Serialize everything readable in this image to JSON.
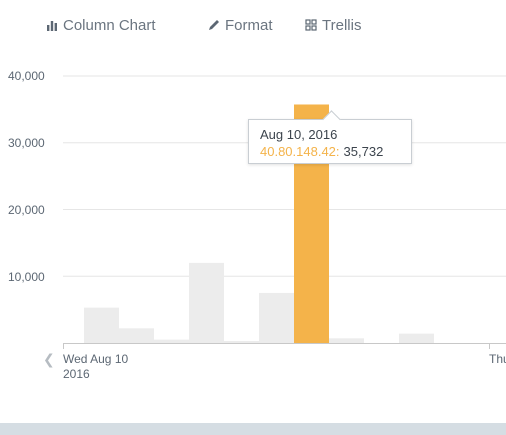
{
  "toolbar": {
    "column_chart": {
      "label": "Column Chart",
      "icon": "bar-chart-icon"
    },
    "format": {
      "label": "Format",
      "icon": "pencil-icon"
    },
    "trellis": {
      "label": "Trellis",
      "icon": "grid-icon"
    }
  },
  "chart_data": {
    "type": "bar",
    "y_ticks": [
      "40,000",
      "30,000",
      "20,000",
      "10,000"
    ],
    "ylim": [
      0,
      40000
    ],
    "grid": true,
    "x_tick_labels": [
      "Wed Aug 10\n2016",
      "Thu"
    ],
    "values": [
      5300,
      2200,
      500,
      12000,
      300,
      7500,
      35732,
      700,
      0,
      1400
    ],
    "highlight_index": 6,
    "colors": {
      "bar": "#ececec",
      "highlight": "#f4b34a",
      "grid": "#e6e6e6",
      "axis": "#c8c8c8"
    },
    "tooltip": {
      "date": "Aug 10, 2016",
      "series": "40.80.148.42:",
      "value": "35,732"
    }
  }
}
